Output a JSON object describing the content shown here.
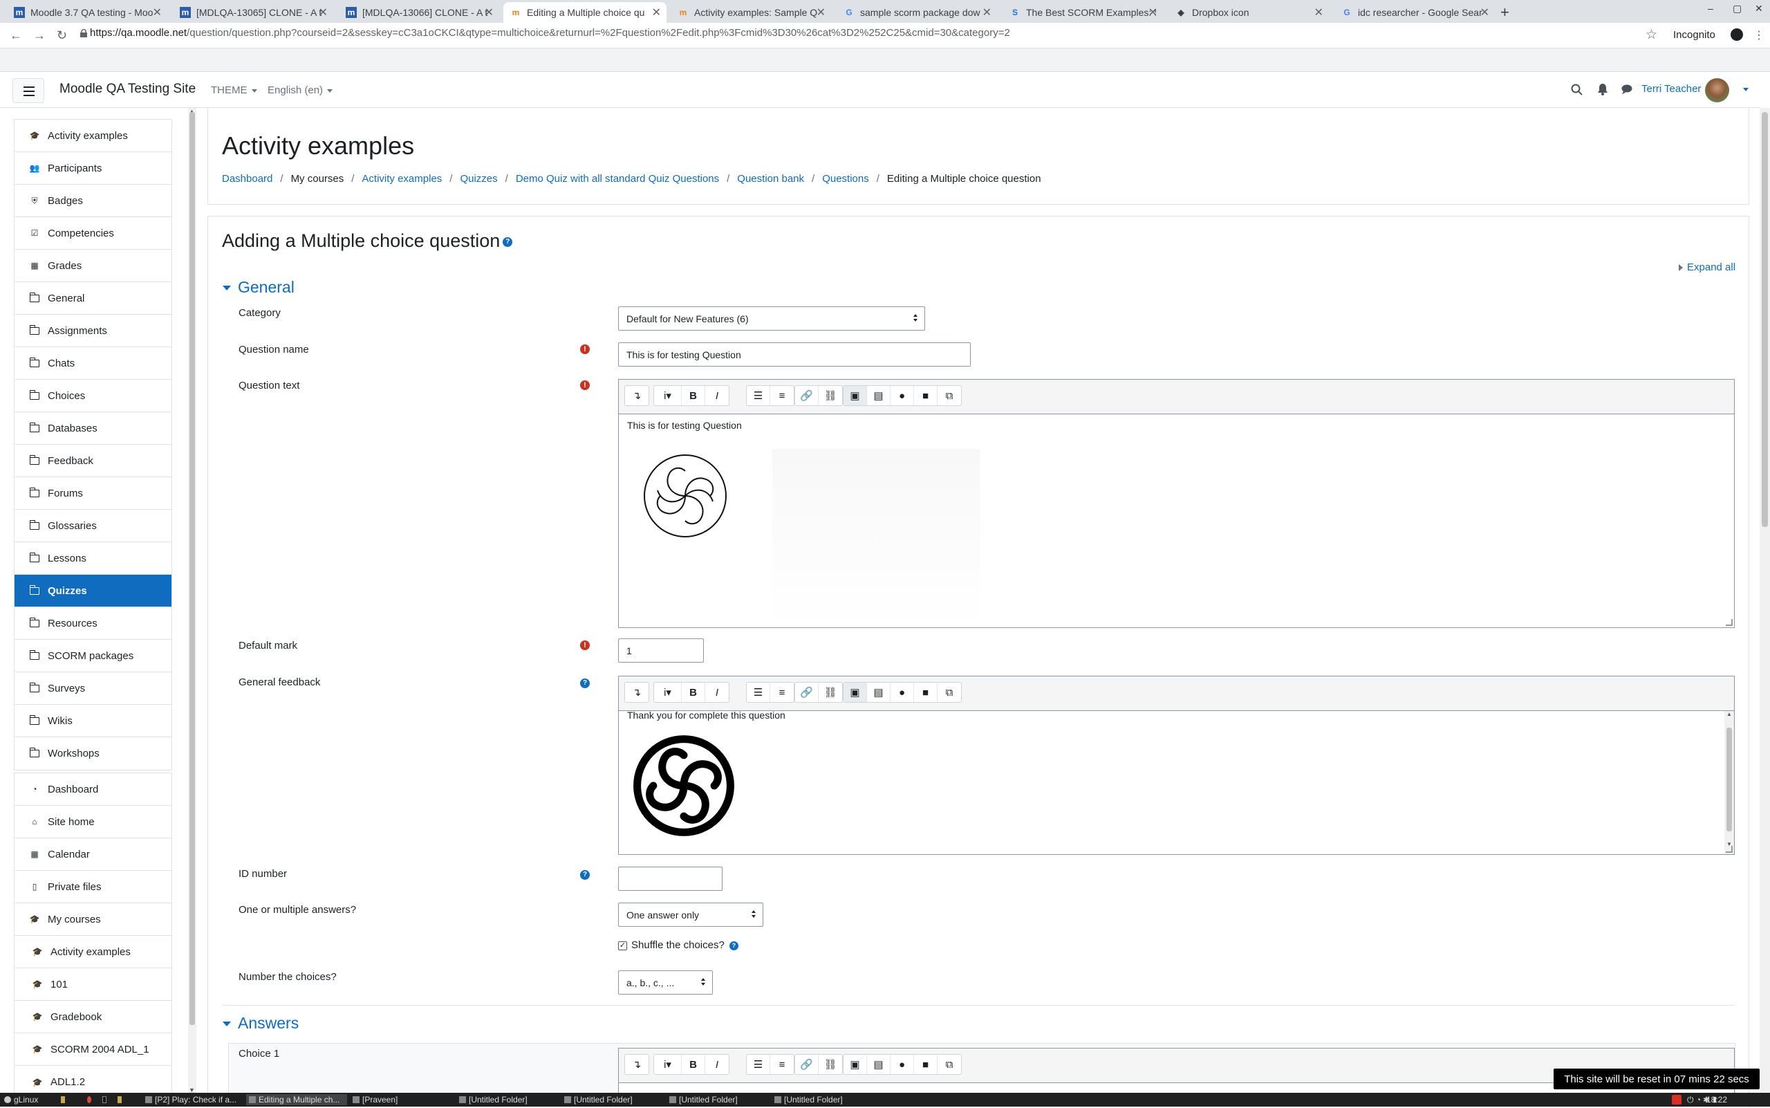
{
  "browser": {
    "tabs": [
      {
        "title": "Moodle 3.7 QA testing - Moo",
        "favicon": "moodle-icon",
        "active": false
      },
      {
        "title": "[MDLQA-13065] CLONE - A t",
        "favicon": "tracker-icon",
        "active": false
      },
      {
        "title": "[MDLQA-13066] CLONE - A t",
        "favicon": "tracker-icon",
        "active": false
      },
      {
        "title": "Editing a Multiple choice qu",
        "favicon": "moodle-icon",
        "active": true
      },
      {
        "title": "Activity examples: Sample Q",
        "favicon": "moodle-icon",
        "active": false
      },
      {
        "title": "sample scorm package dow",
        "favicon": "google-icon",
        "active": false
      },
      {
        "title": "The Best SCORM Examples: S",
        "favicon": "site-icon",
        "active": false
      },
      {
        "title": "Dropbox icon",
        "favicon": "dropbox-icon",
        "active": false
      },
      {
        "title": "idc researcher - Google Sear",
        "favicon": "google-icon",
        "active": false
      }
    ],
    "url_host": "https://qa.moodle.net",
    "url_path": "/question/question.php?courseid=2&sesskey=cC3a1oCKCI&qtype=multichoice&returnurl=%2Fquestion%2Fedit.php%3Fcmid%3D30%26cat%3D2%252C25&cmid=30&category=2",
    "profile_label": "Incognito"
  },
  "navbar": {
    "site_name": "Moodle QA Testing Site",
    "theme_label": "THEME",
    "language_label": "English (en)",
    "user_name": "Terri Teacher"
  },
  "sidebar": {
    "course_items": [
      {
        "label": "Activity examples",
        "icon": "graduation-cap-icon",
        "active": false
      },
      {
        "label": "Participants",
        "icon": "users-icon",
        "active": false
      },
      {
        "label": "Badges",
        "icon": "shield-icon",
        "active": false
      },
      {
        "label": "Competencies",
        "icon": "check-square-icon",
        "active": false
      },
      {
        "label": "Grades",
        "icon": "table-icon",
        "active": false
      },
      {
        "label": "General",
        "icon": "folder-icon",
        "active": false
      },
      {
        "label": "Assignments",
        "icon": "folder-icon",
        "active": false
      },
      {
        "label": "Chats",
        "icon": "folder-icon",
        "active": false
      },
      {
        "label": "Choices",
        "icon": "folder-icon",
        "active": false
      },
      {
        "label": "Databases",
        "icon": "folder-icon",
        "active": false
      },
      {
        "label": "Feedback",
        "icon": "folder-icon",
        "active": false
      },
      {
        "label": "Forums",
        "icon": "folder-icon",
        "active": false
      },
      {
        "label": "Glossaries",
        "icon": "folder-icon",
        "active": false
      },
      {
        "label": "Lessons",
        "icon": "folder-icon",
        "active": false
      },
      {
        "label": "Quizzes",
        "icon": "folder-icon",
        "active": true
      },
      {
        "label": "Resources",
        "icon": "folder-icon",
        "active": false
      },
      {
        "label": "SCORM packages",
        "icon": "folder-icon",
        "active": false
      },
      {
        "label": "Surveys",
        "icon": "folder-icon",
        "active": false
      },
      {
        "label": "Wikis",
        "icon": "folder-icon",
        "active": false
      },
      {
        "label": "Workshops",
        "icon": "folder-icon",
        "active": false
      }
    ],
    "site_items": [
      {
        "label": "Dashboard",
        "icon": "tachometer-icon"
      },
      {
        "label": "Site home",
        "icon": "home-icon"
      },
      {
        "label": "Calendar",
        "icon": "calendar-icon"
      },
      {
        "label": "Private files",
        "icon": "file-icon"
      },
      {
        "label": "My courses",
        "icon": "graduation-cap-icon"
      }
    ],
    "my_courses": [
      {
        "label": "Activity examples"
      },
      {
        "label": "101"
      },
      {
        "label": "Gradebook"
      },
      {
        "label": "SCORM 2004 ADL_1"
      },
      {
        "label": "ADL1.2"
      }
    ]
  },
  "page": {
    "course_title": "Activity examples",
    "breadcrumb": [
      "Dashboard",
      "My courses",
      "Activity examples",
      "Quizzes",
      "Demo Quiz with all standard Quiz Questions",
      "Question bank",
      "Questions",
      "Editing a Multiple choice question"
    ],
    "form_title": "Adding a Multiple choice question",
    "expand_all": "Expand all"
  },
  "form": {
    "general_header": "General",
    "category_label": "Category",
    "category_value": "Default for New Features (6)",
    "question_name_label": "Question name",
    "question_name_value": "This is for testing Question",
    "question_text_label": "Question text",
    "question_text_content": "This is for testing Question",
    "default_mark_label": "Default mark",
    "default_mark_value": "1",
    "general_feedback_label": "General feedback",
    "general_feedback_content": "Thank you for complete this question",
    "id_number_label": "ID number",
    "id_number_value": "",
    "one_or_multiple_label": "One or multiple answers?",
    "one_or_multiple_value": "One answer only",
    "shuffle_label": "Shuffle the choices?",
    "shuffle_checked": true,
    "number_choices_label": "Number the choices?",
    "number_choices_value": "a., b., c., ...",
    "answers_header": "Answers",
    "choice1_label": "Choice 1"
  },
  "notice": {
    "reset_text": "This site will be reset in 07 mins 22 secs"
  },
  "taskbar": {
    "start_label": "gLinux",
    "tasks": [
      "[P2] Play: Check if a...",
      "Editing a Multiple ch...",
      "[Praveen]",
      "[Untitled Folder]",
      "[Untitled Folder]",
      "[Untitled Folder]",
      "[Untitled Folder]"
    ],
    "clock": "18:22"
  },
  "colors": {
    "brand_blue": "#0f6cbf",
    "required_red": "#ca3120"
  }
}
